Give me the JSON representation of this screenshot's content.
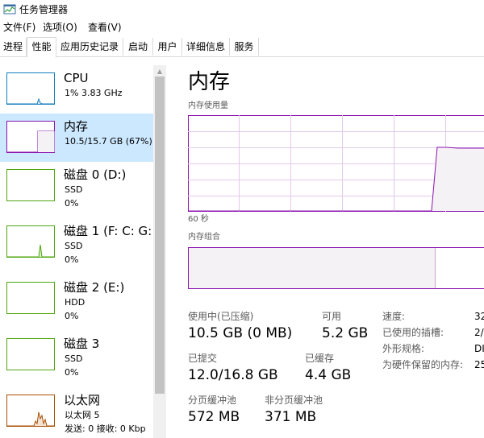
{
  "window": {
    "title": "任务管理器"
  },
  "menu": [
    "文件(F)",
    "选项(O)",
    "查看(V)"
  ],
  "tabs": [
    "进程",
    "性能",
    "应用历史记录",
    "启动",
    "用户",
    "详细信息",
    "服务"
  ],
  "active_tab": "性能",
  "devices": [
    {
      "name": "CPU",
      "line1": "1%  3.83 GHz",
      "line2": "",
      "color": "#117dbb"
    },
    {
      "name": "内存",
      "line1": "10.5/15.7 GB (67%)",
      "line2": "",
      "color": "#8b12ae",
      "selected": true
    },
    {
      "name": "磁盘 0 (D:)",
      "line1": "SSD",
      "line2": "0%",
      "color": "#4da60c"
    },
    {
      "name": "磁盘 1 (F: C: G:",
      "line1": "SSD",
      "line2": "0%",
      "color": "#4da60c"
    },
    {
      "name": "磁盘 2 (E:)",
      "line1": "HDD",
      "line2": "0%",
      "color": "#4da60c"
    },
    {
      "name": "磁盘 3",
      "line1": "SSD",
      "line2": "0%",
      "color": "#4da60c"
    },
    {
      "name": "以太网",
      "line1": "以太网 5",
      "line2": "发送: 0  接收: 0 Kbp",
      "color": "#a74f01"
    }
  ],
  "memory": {
    "title": "内存",
    "usage_label": "内存使用量",
    "time_label": "60 秒",
    "composition_label": "内存组合",
    "usage_level": 0.67,
    "in_use_fraction": 0.67,
    "stats": {
      "in_use_label": "使用中(已压缩)",
      "in_use_value": "10.5 GB (0 MB)",
      "available_label": "可用",
      "available_value": "5.2 GB",
      "committed_label": "已提交",
      "committed_value": "12.0/16.8 GB",
      "cached_label": "已缓存",
      "cached_value": "4.4 GB",
      "paged_label": "分页缓冲池",
      "paged_value": "572 MB",
      "nonpaged_label": "非分页缓冲池",
      "nonpaged_value": "371 MB"
    },
    "right": [
      {
        "label": "速度:",
        "value": "32"
      },
      {
        "label": "已使用的插槽:",
        "value": "2/"
      },
      {
        "label": "外形规格:",
        "value": "DI"
      },
      {
        "label": "为硬件保留的内存:",
        "value": "25"
      }
    ]
  },
  "colors": {
    "memory": "#8b12ae",
    "selected_bg": "#cce8ff"
  }
}
